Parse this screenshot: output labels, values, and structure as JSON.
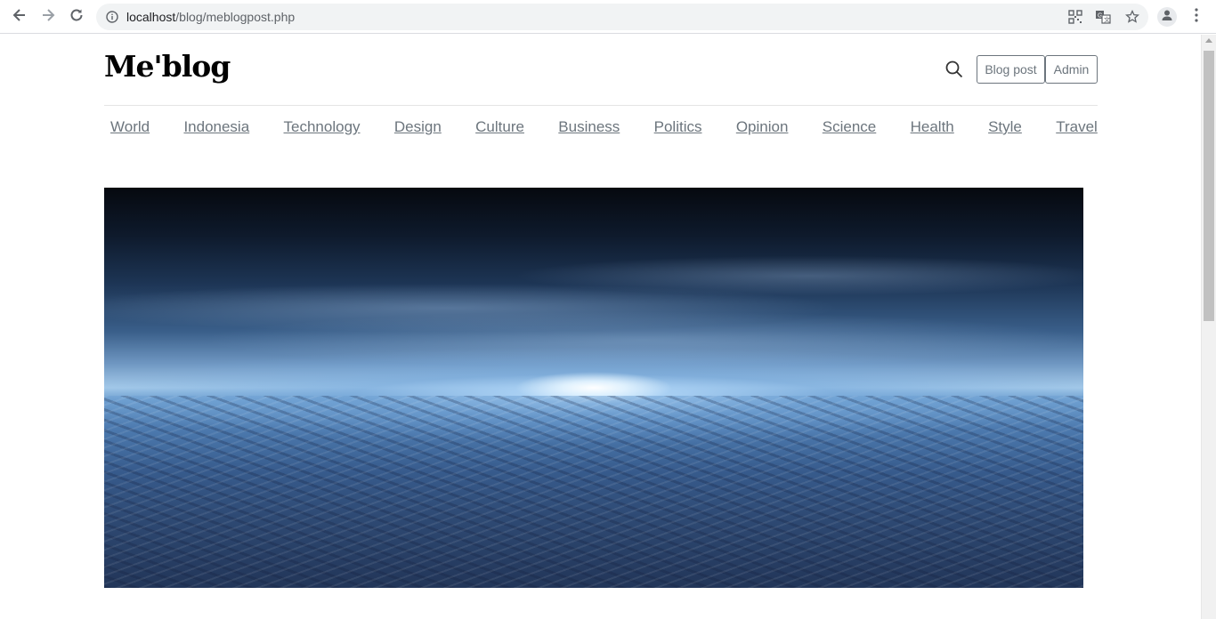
{
  "browser": {
    "url_host": "localhost",
    "url_path": "/blog/meblogpost.php",
    "back_icon": "arrow-left-icon",
    "forward_icon": "arrow-right-icon",
    "reload_icon": "reload-icon",
    "info_icon": "info-icon",
    "qr_icon": "qr-code-icon",
    "translate_icon": "translate-icon",
    "bookmark_icon": "star-icon",
    "profile_icon": "account-icon",
    "menu_icon": "kebab-menu-icon"
  },
  "header": {
    "logo": "Me'blog",
    "search_icon": "search-icon",
    "blog_post_button": "Blog post",
    "admin_button": "Admin"
  },
  "nav": {
    "items": [
      "World",
      "Indonesia",
      "Technology",
      "Design",
      "Culture",
      "Business",
      "Politics",
      "Opinion",
      "Science",
      "Health",
      "Style",
      "Travel"
    ]
  },
  "hero": {
    "image": "earth-horizon-sunrise-image"
  },
  "colors": {
    "muted_text": "#6c757d",
    "border": "#e5e5e5"
  }
}
